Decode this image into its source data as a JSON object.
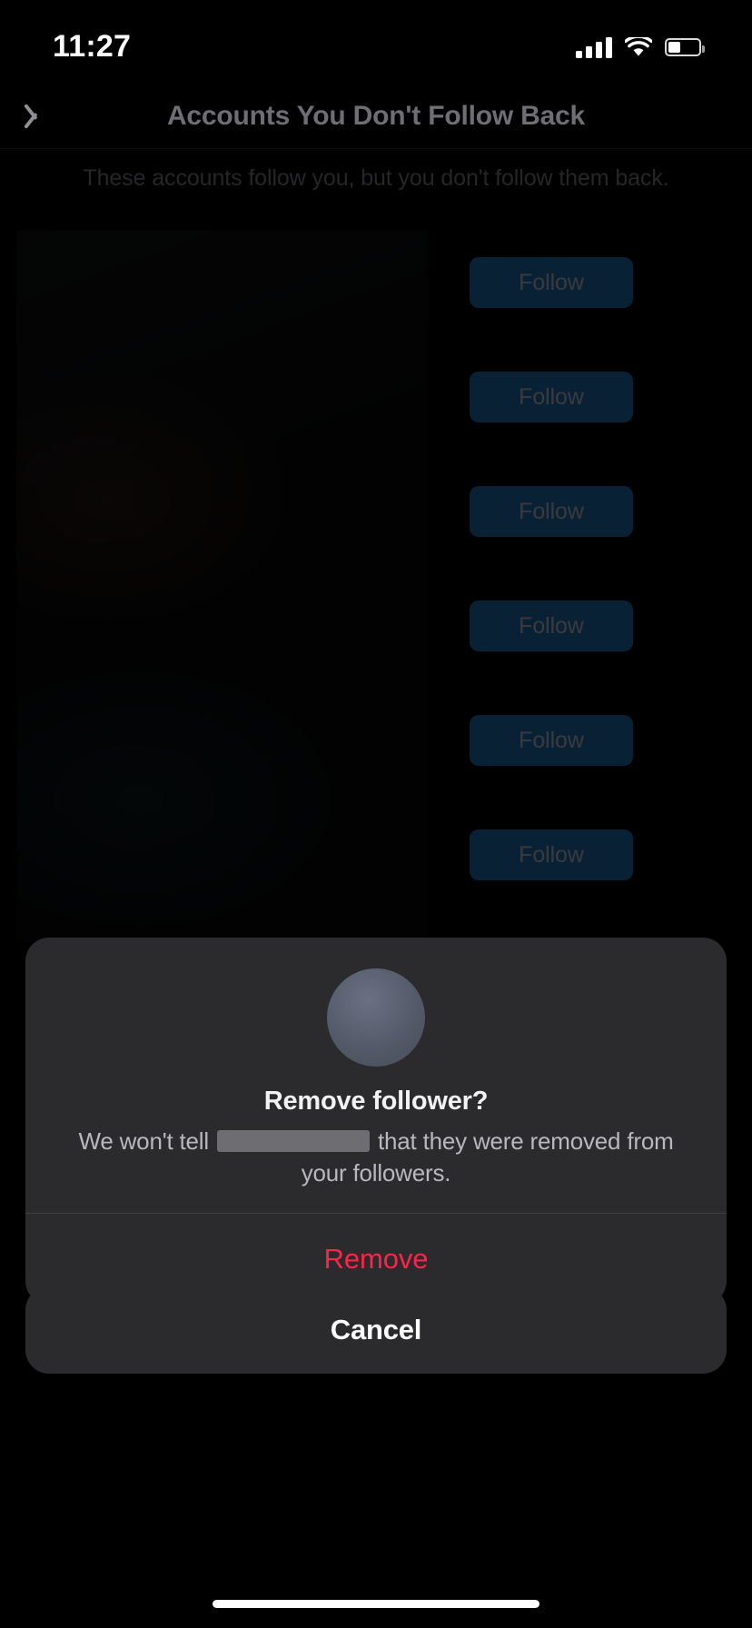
{
  "status_bar": {
    "time": "11:27",
    "cellular_icon": "cellular-signal-icon",
    "wifi_icon": "wifi-icon",
    "battery_icon": "battery-icon"
  },
  "nav": {
    "back_icon": "chevron-left-icon",
    "title": "Accounts You Don't Follow Back"
  },
  "subtitle": "These accounts follow you, but you don't follow them back.",
  "list": {
    "follow_label": "Follow",
    "rows": [
      {
        "follow_label": "Follow"
      },
      {
        "follow_label": "Follow"
      },
      {
        "follow_label": "Follow"
      },
      {
        "follow_label": "Follow"
      },
      {
        "follow_label": "Follow"
      },
      {
        "follow_label": "Follow"
      }
    ]
  },
  "dialog": {
    "avatar_icon": "user-avatar-placeholder",
    "title": "Remove follower?",
    "body_before": "We won't tell",
    "body_redacted": "",
    "body_after": "that they were removed from your followers.",
    "remove_label": "Remove",
    "cancel_label": "Cancel"
  },
  "home_indicator": "home-indicator-bar",
  "colors": {
    "background": "#000000",
    "sheet": "#2b2b2d",
    "follow_button": "#14507e",
    "destructive": "#fc2448",
    "nav_title": "#6e6e73",
    "subtitle": "#5c5c60"
  }
}
